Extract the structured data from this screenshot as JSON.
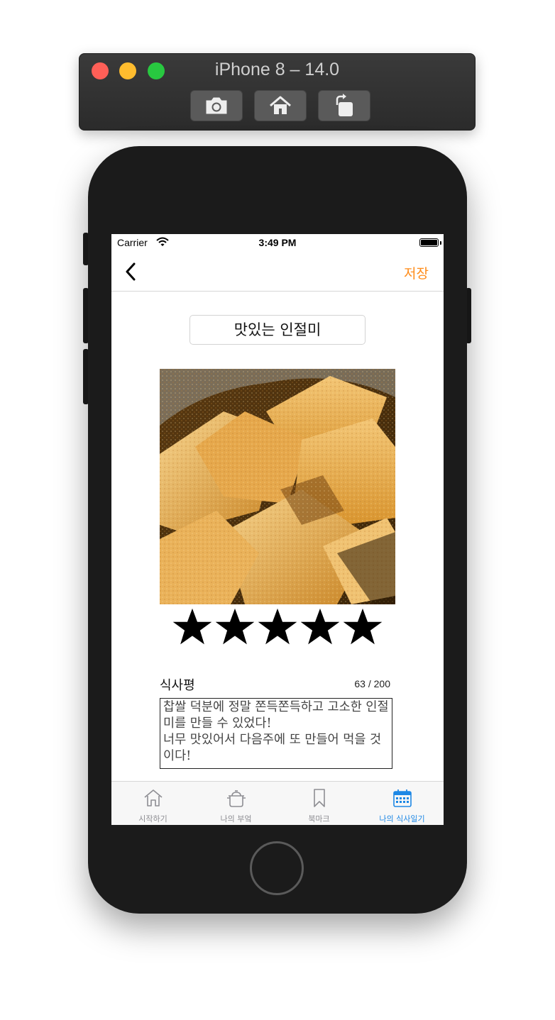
{
  "simulator": {
    "title": "iPhone 8 – 14.0",
    "toolbar": [
      {
        "name": "screenshot-icon"
      },
      {
        "name": "home-icon"
      },
      {
        "name": "rotate-icon"
      }
    ]
  },
  "status_bar": {
    "carrier": "Carrier",
    "time": "3:49 PM",
    "battery_level": 1.0
  },
  "nav": {
    "back_icon": "chevron-left-icon",
    "save_label": "저장",
    "accent_color": "#ff8c1a"
  },
  "diary": {
    "title": "맛있는 인절미",
    "photo_icon": "injeolmi-photo",
    "rating": 5,
    "rating_max": 5,
    "review_label": "식사평",
    "review_count": "63 / 200",
    "review_text": "찹쌀 덕분에 정말 쫀득쫀득하고 고소한 인절미를 만들 수 있었다!\n너무 맛있어서 다음주에 또 만들어 먹을 것이다!"
  },
  "tab_bar": {
    "active_color": "#1e88e5",
    "items": [
      {
        "label": "시작하기",
        "icon": "house-icon",
        "active": false
      },
      {
        "label": "나의 부엌",
        "icon": "pot-icon",
        "active": false
      },
      {
        "label": "북마크",
        "icon": "bookmark-icon",
        "active": false
      },
      {
        "label": "나의 식사일기",
        "icon": "calendar-icon",
        "active": true
      }
    ]
  }
}
